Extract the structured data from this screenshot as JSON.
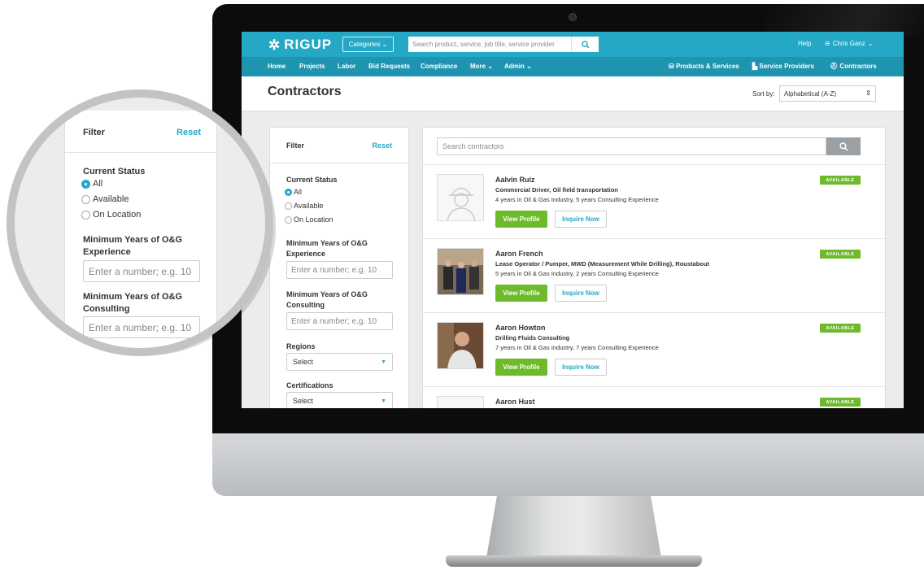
{
  "app": {
    "logo_text": "RIGUP",
    "categories_label": "Categories",
    "search_placeholder": "Search product, service, job title, service provider",
    "help_label": "Help",
    "user_name": "Chris Ganz"
  },
  "nav": {
    "items": [
      "Home",
      "Projects",
      "Labor",
      "Bid Requests",
      "Compliance",
      "More",
      "Admin"
    ],
    "right_items": [
      "Products & Services",
      "Service Providers",
      "Contractors"
    ]
  },
  "page": {
    "title": "Contractors",
    "sort_label": "Sort by:",
    "sort_value": "Alphabetical (A-Z)"
  },
  "filter": {
    "title": "Filter",
    "reset": "Reset",
    "status_label": "Current Status",
    "status_options": [
      "All",
      "Available",
      "On Location"
    ],
    "status_selected": "All",
    "min_og_label": "Minimum Years of O&G Experience",
    "min_og_placeholder": "Enter a number; e.g. 10",
    "min_consult_label": "Minimum Years of O&G Consulting",
    "min_consult_placeholder": "Enter a number; e.g. 10",
    "regions_label": "Regions",
    "regions_value": "Select",
    "certs_label": "Certifications",
    "certs_value": "Select"
  },
  "results": {
    "search_placeholder": "Search contractors",
    "view_label": "View Profile",
    "inquire_label": "Inquire Now",
    "badge_label": "AVAILABLE",
    "contractors": [
      {
        "name": "Aalvin Ruiz",
        "role": "Commercial Driver, Oil field transportation",
        "experience": "4 years in Oil & Gas Industry,  5 years Consulting Experience"
      },
      {
        "name": "Aaron French",
        "role": "Lease Operator / Pumper, MWD (Measurement While Drilling), Roustabout",
        "experience": "5 years in Oil & Gas Industry,  2 years Consulting Experience"
      },
      {
        "name": "Aaron Howton",
        "role": "Drilling Fluids Consulting",
        "experience": "7 years in Oil & Gas Industry,  7 years Consulting Experience"
      },
      {
        "name": "Aaron Hust",
        "role": "",
        "experience": ""
      }
    ]
  },
  "colors": {
    "brand": "#25a8c6",
    "nav": "#1f94b0",
    "available": "#6dbb2a"
  }
}
